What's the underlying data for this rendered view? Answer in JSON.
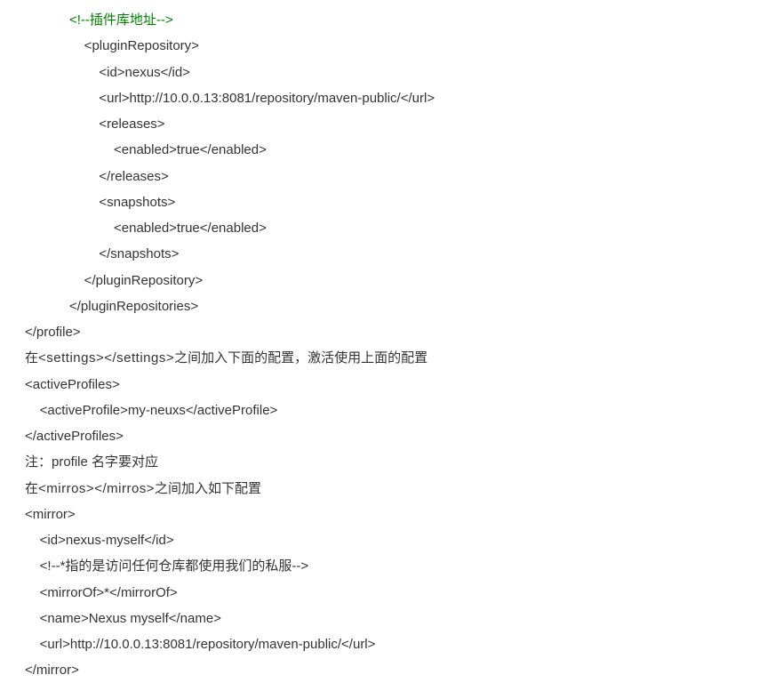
{
  "lines": [
    {
      "indent": 3,
      "text": "<!--插件库地址-->",
      "cls": "comment"
    },
    {
      "indent": 4,
      "text": "<pluginRepository>"
    },
    {
      "indent": 5,
      "text": "<id>nexus</id>"
    },
    {
      "indent": 5,
      "text": "<url>http://10.0.0.13:8081/repository/maven-public/</url>"
    },
    {
      "indent": 5,
      "text": "<releases>"
    },
    {
      "indent": 6,
      "text": "<enabled>true</enabled>"
    },
    {
      "indent": 5,
      "text": "</releases>"
    },
    {
      "indent": 5,
      "text": "<snapshots>"
    },
    {
      "indent": 6,
      "text": "<enabled>true</enabled>"
    },
    {
      "indent": 5,
      "text": "</snapshots>"
    },
    {
      "indent": 4,
      "text": "</pluginRepository>"
    },
    {
      "indent": 3,
      "text": "</pluginRepositories>"
    },
    {
      "indent": 0,
      "text": "</profile>"
    }
  ],
  "para1_prefix": "在",
  "para1_code": "<settings></settings>",
  "para1_suffix": "之间加入下面的配置，激活使用上面的配置",
  "lines2": [
    {
      "indent": 0,
      "text": "<activeProfiles>"
    },
    {
      "indent": 1,
      "text": "<activeProfile>my-neuxs</activeProfile>"
    },
    {
      "indent": 0,
      "text": "</activeProfiles>"
    }
  ],
  "note_line": "注：profile 名字要对应",
  "para2_prefix": "在",
  "para2_code": "<mirros></mirros>",
  "para2_suffix": "之间加入如下配置",
  "lines3": [
    {
      "indent": 0,
      "text": "<mirror>"
    },
    {
      "indent": 1,
      "text": "<id>nexus-myself</id>"
    },
    {
      "indent": 1,
      "text": "<!--*指的是访问任何仓库都使用我们的私服-->"
    },
    {
      "indent": 1,
      "text": "<mirrorOf>*</mirrorOf>"
    },
    {
      "indent": 1,
      "text": "<name>Nexus myself</name>"
    },
    {
      "indent": 1,
      "text": "<url>http://10.0.0.13:8081/repository/maven-public/</url>"
    },
    {
      "indent": 0,
      "text": "</mirror>"
    }
  ]
}
